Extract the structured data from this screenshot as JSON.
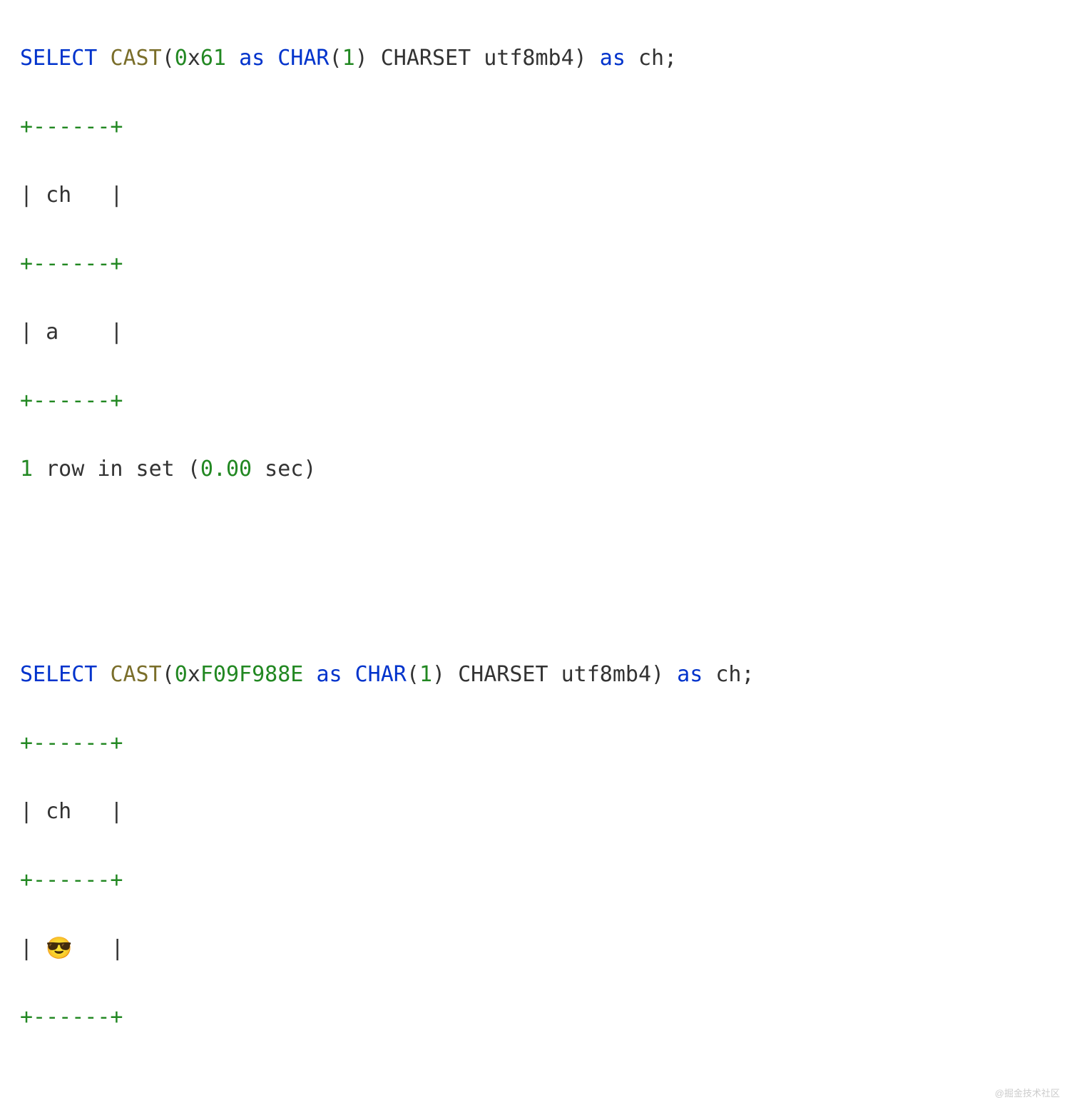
{
  "watermark": "@掘金技术社区",
  "q1": {
    "select": "SELECT",
    "cast": "CAST",
    "lp": "(",
    "hex_zero": "0",
    "hex_x": "x",
    "hex_val": "61",
    "as1": "as",
    "char": "CHAR",
    "lp2": "(",
    "one": "1",
    "rp2": ")",
    "charset": " CHARSET utf8mb4",
    "rp": ")",
    "as2": "as",
    "alias": " ch;",
    "border": "+------+",
    "header": "| ch   |",
    "row": "| a    |",
    "status_n1": "1",
    "status_mid": " row in set (",
    "status_n2": "0.00",
    "status_end": " sec)"
  },
  "q2": {
    "select": "SELECT",
    "cast": "CAST",
    "lp": "(",
    "hex_zero": "0",
    "hex_x": "x",
    "hex_val": "F09F988E",
    "as1": "as",
    "char": "CHAR",
    "lp2": "(",
    "one": "1",
    "rp2": ")",
    "charset": " CHARSET utf8mb4",
    "rp": ")",
    "as2": "as",
    "alias": " ch;",
    "border": "+------+",
    "header": "| ch   |",
    "row": "| 😎   |"
  }
}
